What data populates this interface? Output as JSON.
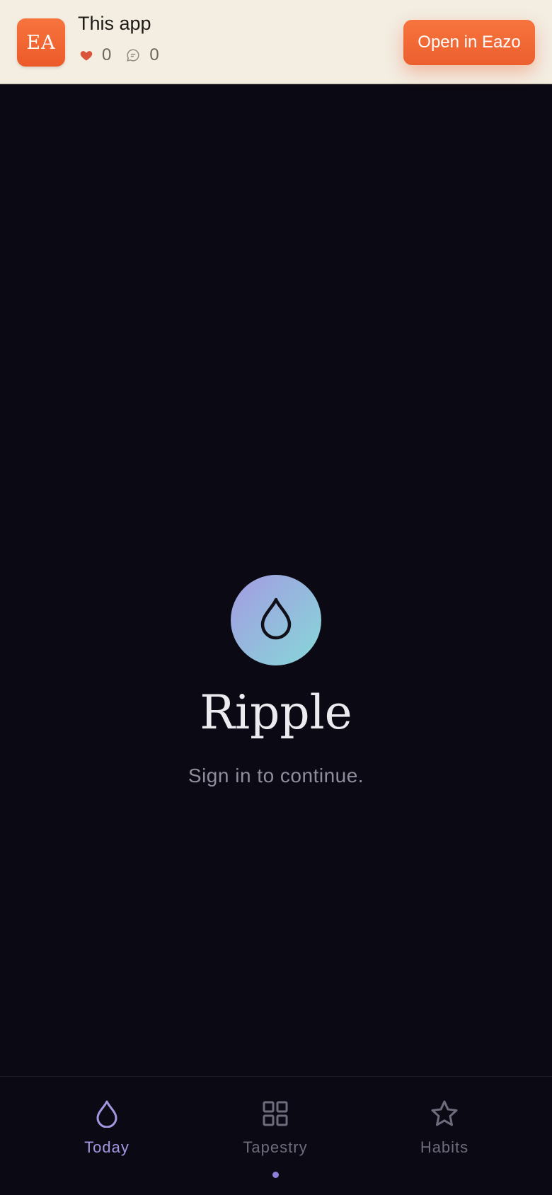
{
  "banner": {
    "icon_text": "EA",
    "title": "This app",
    "likes": "0",
    "comments": "0",
    "open_button": "Open in Eazo",
    "colors": {
      "background": "#f3ede2",
      "accent": "#ec5a2a",
      "heart": "#d9543a"
    }
  },
  "main": {
    "logo_icon": "droplet-icon",
    "app_name": "Ripple",
    "subtitle": "Sign in to continue."
  },
  "tabbar": {
    "tabs": [
      {
        "label": "Today",
        "icon": "droplet-icon",
        "active": true
      },
      {
        "label": "Tapestry",
        "icon": "grid-icon",
        "active": false
      },
      {
        "label": "Habits",
        "icon": "star-icon",
        "active": false
      }
    ],
    "colors": {
      "active": "#a496e0",
      "inactive": "#6e6c7c",
      "background": "#0b0a14"
    }
  }
}
